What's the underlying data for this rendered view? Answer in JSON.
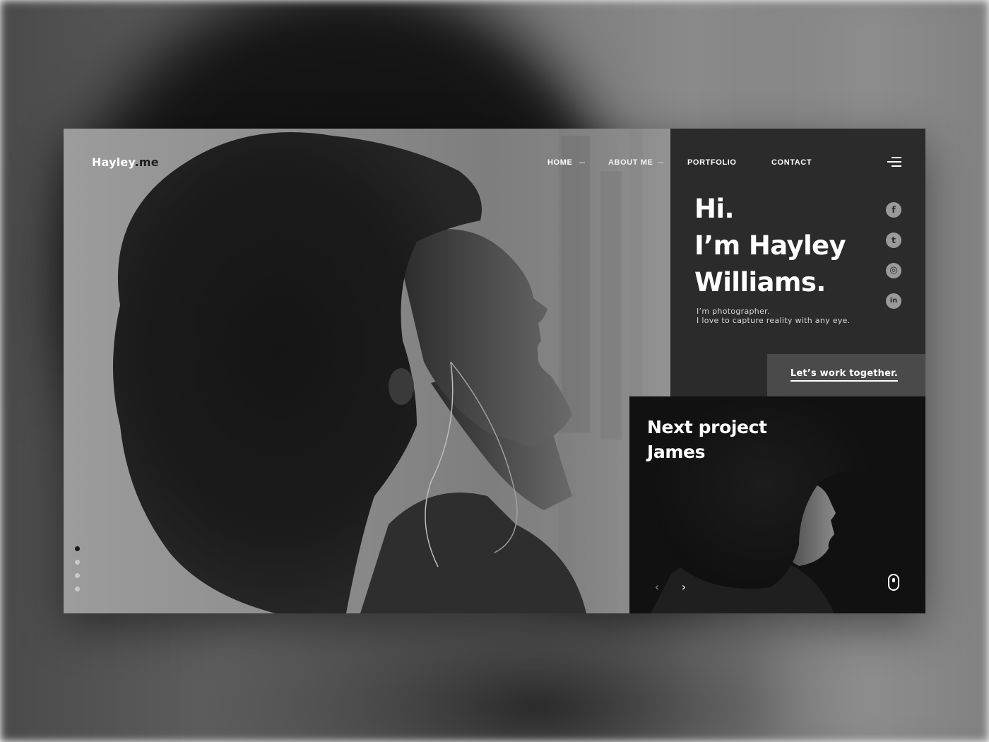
{
  "brand": {
    "logo_main": "Hayley",
    "logo_suffix": ".me"
  },
  "nav": {
    "items": [
      {
        "label": "HOME",
        "active": true
      },
      {
        "label": "ABOUT ME",
        "active": false
      },
      {
        "label": "PORTFOLIO",
        "active": false
      },
      {
        "label": "CONTACT",
        "active": false
      }
    ],
    "menu_icon": "hamburger-menu-icon"
  },
  "intro": {
    "line1": "Hi.",
    "line2": "I’m Hayley",
    "line3": "Williams.",
    "tagline1": "I’m photographer.",
    "tagline2": "I love to capture reality with any eye."
  },
  "social": [
    {
      "icon": "facebook-icon",
      "glyph": "f"
    },
    {
      "icon": "twitter-icon",
      "glyph": "t"
    },
    {
      "icon": "instagram-icon",
      "glyph": "◎"
    },
    {
      "icon": "linkedin-icon",
      "glyph": "in"
    }
  ],
  "cta": {
    "label": "Let’s work together."
  },
  "next_project": {
    "line1": "Next project",
    "line2": "James",
    "prev_icon": "chevron-left-icon",
    "next_icon": "chevron-right-icon",
    "scroll_icon": "mouse-scroll-icon"
  },
  "pagination": {
    "total": 4,
    "active_index": 0
  },
  "colors": {
    "panel_dark": "#2b2b2b",
    "cta_bg": "#4a4a4a",
    "text_light": "#ffffff",
    "social_circle": "#9a9a9a"
  }
}
